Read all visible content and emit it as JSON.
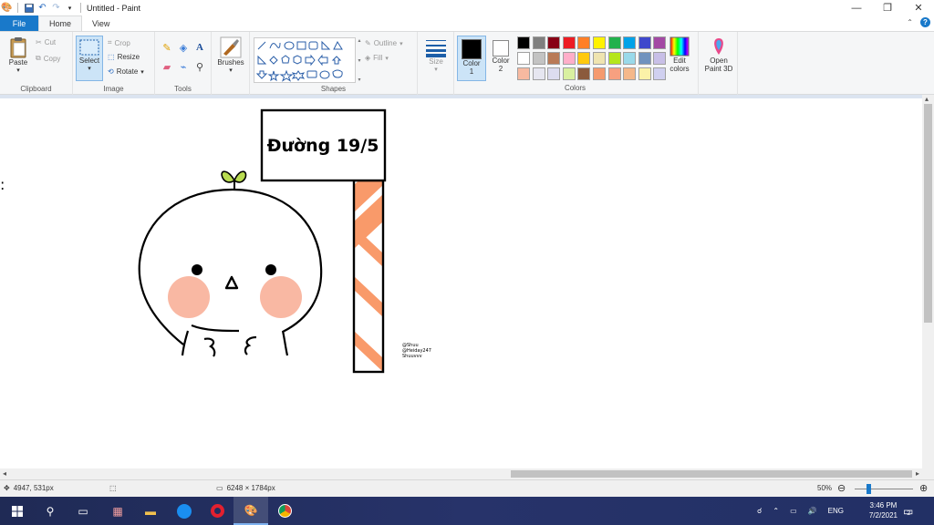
{
  "window": {
    "title": "Untitled - Paint",
    "minimize": "—",
    "restore": "❐",
    "close": "✕"
  },
  "tabs": [
    {
      "label": "File"
    },
    {
      "label": "Home"
    },
    {
      "label": "View"
    }
  ],
  "ribbon": {
    "clipboard": {
      "label": "Clipboard",
      "paste": "Paste",
      "cut": "Cut",
      "copy": "Copy"
    },
    "image": {
      "label": "Image",
      "select": "Select",
      "crop": "Crop",
      "resize": "Resize",
      "rotate": "Rotate"
    },
    "tools": {
      "label": "Tools"
    },
    "brushes": {
      "label": "Brushes"
    },
    "shapes": {
      "label": "Shapes",
      "outline": "Outline",
      "fill": "Fill"
    },
    "size": {
      "label": "Size"
    },
    "color1": {
      "label_line1": "Color",
      "label_line2": "1",
      "value": "#000000"
    },
    "color2": {
      "label_line1": "Color",
      "label_line2": "2",
      "value": "#ffffff"
    },
    "colors": {
      "label": "Colors",
      "row1": [
        "#000000",
        "#7f7f7f",
        "#880015",
        "#ed1c24",
        "#ff7f27",
        "#fff200",
        "#22b14c",
        "#00a2e8",
        "#3f48cc",
        "#a349a4"
      ],
      "row2": [
        "#ffffff",
        "#c3c3c3",
        "#b97a57",
        "#ffaec9",
        "#ffc90e",
        "#efe4b0",
        "#b5e61d",
        "#99d9ea",
        "#7092be",
        "#c8bfe7"
      ],
      "row3": [
        "#f7b9a0",
        "#e6e6f0",
        "#dcdcf0",
        "#d9f0a0",
        "#8b5a3c",
        "#f59a6e",
        "#f7a080",
        "#f5b88a",
        "#fbf2a8",
        "#d0d0f0"
      ]
    },
    "edit_colors": {
      "line1": "Edit",
      "line2": "colors"
    },
    "paint3d": {
      "line1": "Open",
      "line2": "Paint 3D"
    }
  },
  "drawing": {
    "sign_text": "Đường 19/5",
    "credit1": "@Shuu",
    "credit2": "@Heiday247",
    "credit3": "Shuuvvv",
    "cursor_mark": ":",
    "accent": "#f99a6a",
    "blush": "#f9b8a3",
    "sprout": "#b9dc50"
  },
  "status": {
    "position": "4947, 531px",
    "size": "6248 × 1784px",
    "zoom": "50%"
  },
  "tray": {
    "lang": "ENG",
    "time": "3:46 PM",
    "date": "7/2/2021",
    "notif": "2"
  }
}
